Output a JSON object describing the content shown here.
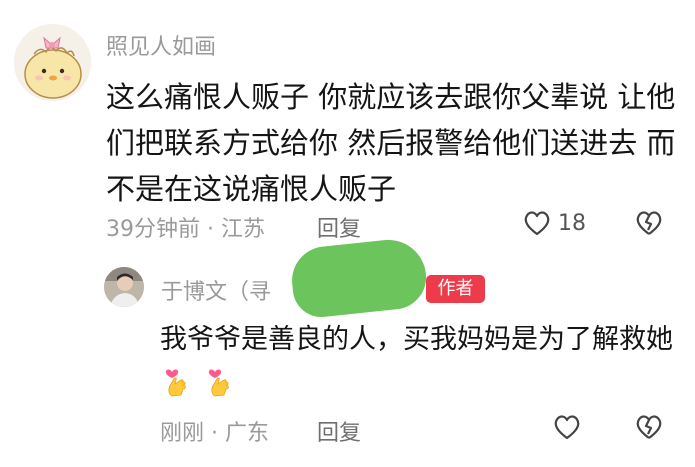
{
  "comment": {
    "username": "照见人如画",
    "text": "这么痛恨人贩子 你就应该去跟你父辈说 让他们把联系方式给你 然后报警给他们送进去 而不是在这说痛恨人贩子",
    "meta": "39分钟前 · 江苏",
    "reply_label": "回复",
    "like_count": "18",
    "avatar_icon": "chick-avatar-icon"
  },
  "reply": {
    "username": "于博文（寻",
    "author_badge": "作者",
    "text": "我爷爷是善良的人，买我妈妈是为了解救她",
    "meta": "刚刚 · 广东",
    "reply_label": "回复",
    "avatar_icon": "person-photo-avatar"
  },
  "colors": {
    "badge": "#ee3b4b",
    "redaction": "#6cc45c",
    "meta_gray": "#9a9a9a"
  }
}
